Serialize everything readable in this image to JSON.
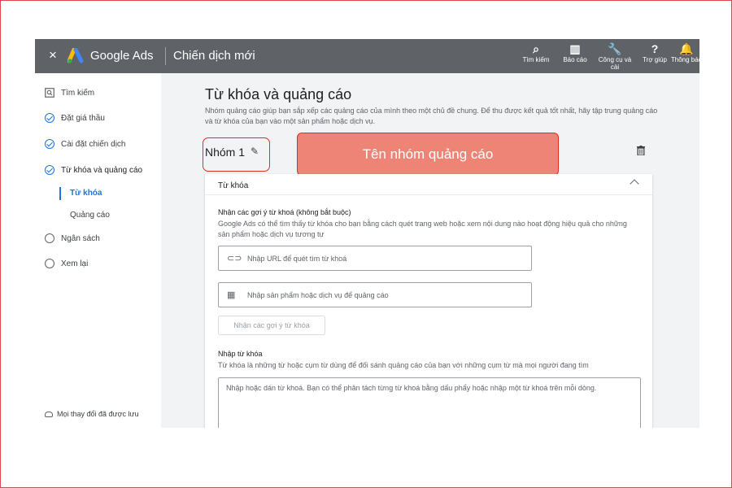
{
  "header": {
    "close_glyph": "×",
    "brand": "Google Ads",
    "campaign_title": "Chiến dịch mới",
    "tools": [
      {
        "icon": "search-icon",
        "glyph": "⌕",
        "label": "Tìm kiếm"
      },
      {
        "icon": "reports-icon",
        "glyph": "▥",
        "label": "Báo cáo"
      },
      {
        "icon": "wrench-icon",
        "glyph": "🔧",
        "label": "Công cụ và cài"
      },
      {
        "icon": "help-icon",
        "glyph": "?",
        "label": "Trợ giúp"
      },
      {
        "icon": "bell-icon",
        "glyph": "🔔",
        "label": "Thông báo"
      }
    ]
  },
  "sidebar": {
    "items": [
      {
        "label": "Tìm kiếm",
        "state": "search"
      },
      {
        "label": "Đặt giá thầu",
        "state": "done"
      },
      {
        "label": "Cài đặt chiến dịch",
        "state": "done"
      },
      {
        "label": "Từ khóa và quảng cáo",
        "state": "done"
      },
      {
        "label": "Từ khóa",
        "state": "sub-current"
      },
      {
        "label": "Quảng cáo",
        "state": "sub"
      },
      {
        "label": "Ngân sách",
        "state": "todo"
      },
      {
        "label": "Xem lại",
        "state": "todo"
      }
    ],
    "save_status": "Mọi thay đổi đã được lưu"
  },
  "main": {
    "title": "Từ khóa và quảng cáo",
    "description": "Nhóm quảng cáo giúp bạn sắp xếp các quảng cáo của mình theo một chủ đề chung. Để thu được kết quả tốt nhất, hãy tập trung quảng cáo và từ khóa của bạn vào một sản phẩm hoặc dịch vụ.",
    "group_name": "Nhóm 1",
    "pencil_glyph": "✎",
    "callout": "Tên nhóm quảng cáo",
    "card": {
      "title": "Từ khóa",
      "suggest_label": "Nhận các gợi ý từ khoá (không bắt buộc)",
      "suggest_desc": "Google Ads có thể tìm thấy từ khóa cho bạn bằng cách quét trang web hoặc xem nội dung nào hoạt động hiệu quả cho những sản phẩm hoặc dịch vụ tương tự",
      "url_icon_glyph": "⊂⊃",
      "url_placeholder": "Nhập URL để quét tìm từ khoá",
      "product_icon_glyph": "▦",
      "product_placeholder": "Nhập sản phẩm hoặc dịch vụ để quảng cáo",
      "suggest_button": "Nhận các gợi ý từ khóa",
      "enter_label": "Nhập từ khóa",
      "enter_desc": "Từ khóa là những từ hoặc cụm từ dùng để đối sánh quảng cáo của bạn với những cụm từ mà mọi người đang tìm",
      "textarea_placeholder": "Nhập hoặc dán từ khoá. Bạn có thể phân tách từng từ khoá bằng dấu phẩy hoặc nhập một từ khoá trên mỗi dòng."
    }
  },
  "colors": {
    "topbar": "#5f6368",
    "accent": "#1a73e8",
    "highlight_border": "#d93025",
    "callout_fill": "#ed8476"
  }
}
